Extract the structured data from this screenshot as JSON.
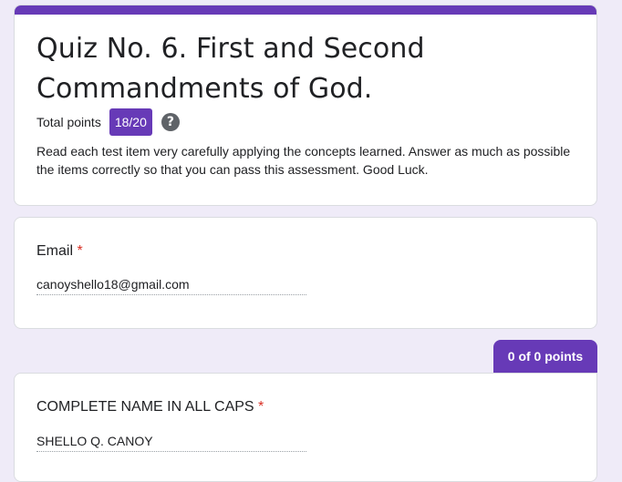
{
  "form": {
    "title_line1": "Quiz No. 6. First and Second",
    "title_line2": "Commandments of God.",
    "points_label": "Total points",
    "points_value": "18/20",
    "help_glyph": "?",
    "description": "Read each test item very carefully applying the concepts learned. Answer as much as possible the items correctly so that you can pass this assessment. Good Luck.",
    "accent_color": "#673ab7"
  },
  "email_question": {
    "label": "Email",
    "required_mark": "*",
    "answer": "canoyshello18@gmail.com"
  },
  "score_tab": {
    "label": "0 of 0 points"
  },
  "name_question": {
    "label": "COMPLETE NAME IN ALL CAPS",
    "required_mark": "*",
    "answer": "SHELLO Q. CANOY"
  },
  "icons": {
    "help": "help-circle-icon"
  }
}
